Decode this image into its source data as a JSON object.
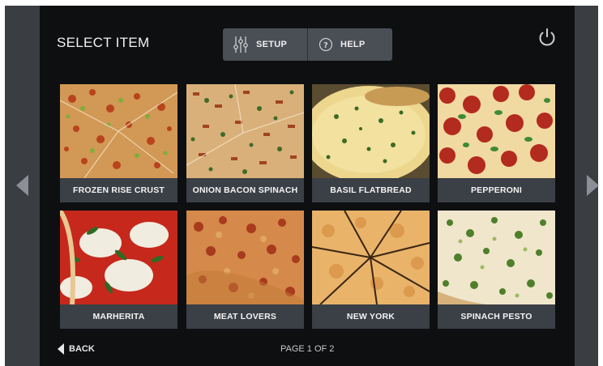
{
  "header": {
    "title": "SELECT ITEM",
    "setup_label": "SETUP",
    "help_label": "HELP"
  },
  "items": [
    {
      "label": "FROZEN RISE CRUST"
    },
    {
      "label": "ONION BACON SPINACH"
    },
    {
      "label": "BASIL FLATBREAD"
    },
    {
      "label": "PEPPERONI"
    },
    {
      "label": "MARHERITA"
    },
    {
      "label": "MEAT LOVERS"
    },
    {
      "label": "NEW YORK"
    },
    {
      "label": "SPINACH PESTO"
    }
  ],
  "footer": {
    "back_label": "BACK",
    "page_text": "PAGE 1 OF 2"
  },
  "icons": {
    "setup": "sliders-icon",
    "help": "question-circle-icon",
    "power": "power-icon",
    "nav_left": "chevron-left-icon",
    "nav_right": "chevron-right-icon",
    "back": "back-arrow-icon"
  },
  "colors": {
    "screen_bg": "#0e0f11",
    "bezel": "#3a3d42",
    "button_bg": "#4a4e55",
    "label_bg": "#3b3f46"
  }
}
